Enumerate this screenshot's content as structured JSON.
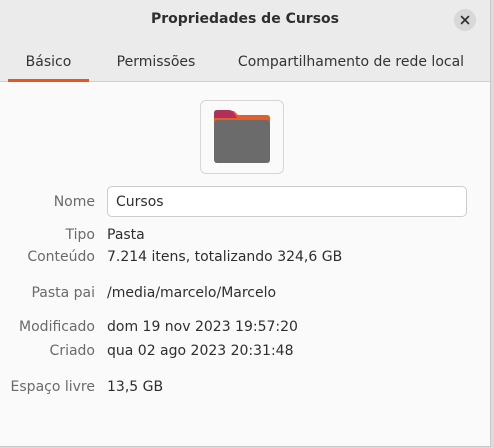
{
  "window": {
    "title": "Propriedades de Cursos",
    "close_icon": "close-icon"
  },
  "tabs": [
    {
      "label": "Básico",
      "active": true
    },
    {
      "label": "Permissões",
      "active": false
    },
    {
      "label": "Compartilhamento de rede local",
      "active": false
    }
  ],
  "icon": {
    "name": "folder-icon",
    "colors": {
      "tab": "#b0305a",
      "back": "#e35f2a",
      "body": "#6b6b6b"
    }
  },
  "fields": {
    "name": {
      "label": "Nome",
      "value": "Cursos"
    },
    "type": {
      "label": "Tipo",
      "value": "Pasta"
    },
    "contents": {
      "label": "Conteúdo",
      "value": "7.214 itens, totalizando 324,6 GB"
    },
    "parent": {
      "label": "Pasta pai",
      "value": "/media/marcelo/Marcelo"
    },
    "modified": {
      "label": "Modificado",
      "value": "dom 19 nov 2023 19:57:20"
    },
    "created": {
      "label": "Criado",
      "value": "qua 02 ago 2023 20:31:48"
    },
    "free_space": {
      "label": "Espaço livre",
      "value": "13,5 GB"
    }
  },
  "colors": {
    "accent": "#e95420"
  }
}
